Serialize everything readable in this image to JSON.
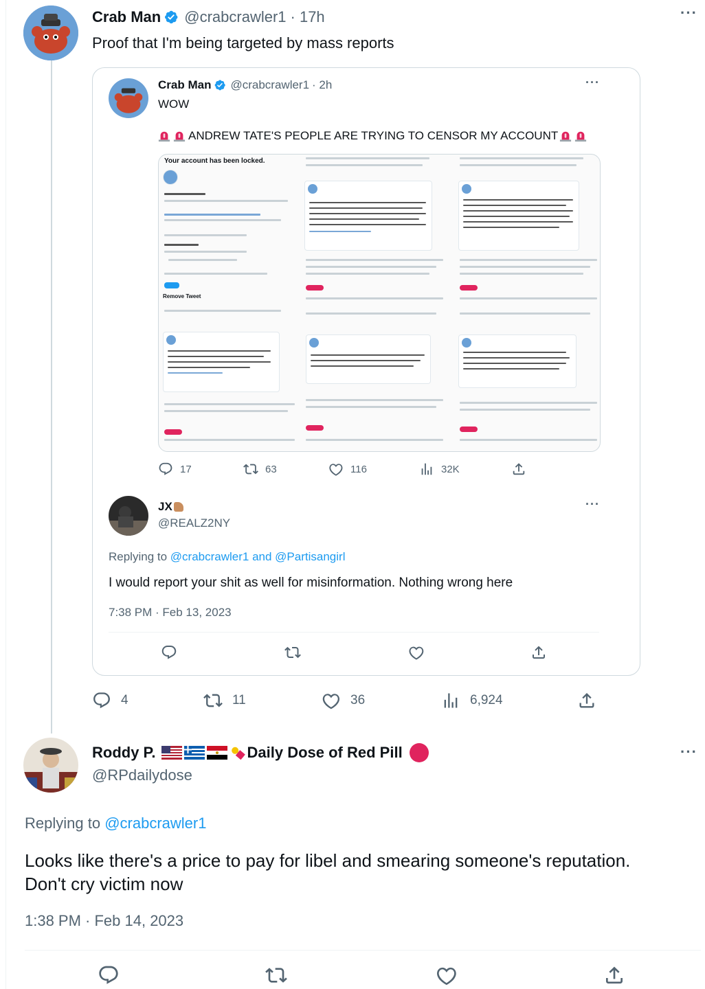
{
  "main_tweet": {
    "author_name": "Crab Man",
    "handle": "@crabcrawler1",
    "time": "· 17h",
    "text": "Proof that I'm being targeted by mass reports",
    "counts": {
      "replies": "4",
      "retweets": "11",
      "likes": "36",
      "views": "6,924"
    }
  },
  "quoted_tweet": {
    "author_name": "Crab Man",
    "handle": "@crabcrawler1",
    "time": "· 2h",
    "text_line1": "WOW",
    "text_line2": "ANDREW TATE'S PEOPLE ARE TRYING TO CENSOR MY ACCOUNT",
    "counts": {
      "replies": "17",
      "retweets": "63",
      "likes": "116",
      "views": "32K"
    },
    "image": {
      "header": "Your account has been locked.",
      "section": "Remove Tweet"
    }
  },
  "nested_reply": {
    "author_name": "JX",
    "handle": "@REALZ2NY",
    "replying_prefix": "Replying to",
    "replying_targets": "@crabcrawler1 and @Partisangirl",
    "text": "I would report your shit as well for misinformation. Nothing wrong here",
    "timestamp": "7:38 PM · Feb 13, 2023"
  },
  "reply": {
    "author_name": "Roddy P.",
    "author_suffix": "Daily Dose of Red Pill",
    "handle": "@RPdailydose",
    "replying_prefix": "Replying to",
    "replying_target": "@crabcrawler1",
    "text_line1": "Looks like there's a price to pay for libel and smearing someone's reputation.",
    "text_line2": "Don't cry victim now",
    "timestamp": "1:38 PM · Feb 14, 2023"
  },
  "icons": [
    "verified-badge-icon",
    "reply-icon",
    "retweet-icon",
    "like-icon",
    "views-icon",
    "share-icon",
    "more-icon",
    "siren-emoji-icon",
    "flag-icon",
    "pill-icon",
    "red-circle-icon"
  ],
  "colors": {
    "accent": "#1d9bf0",
    "muted": "#536471",
    "border": "#cfd9de",
    "alert": "#e0245e"
  }
}
